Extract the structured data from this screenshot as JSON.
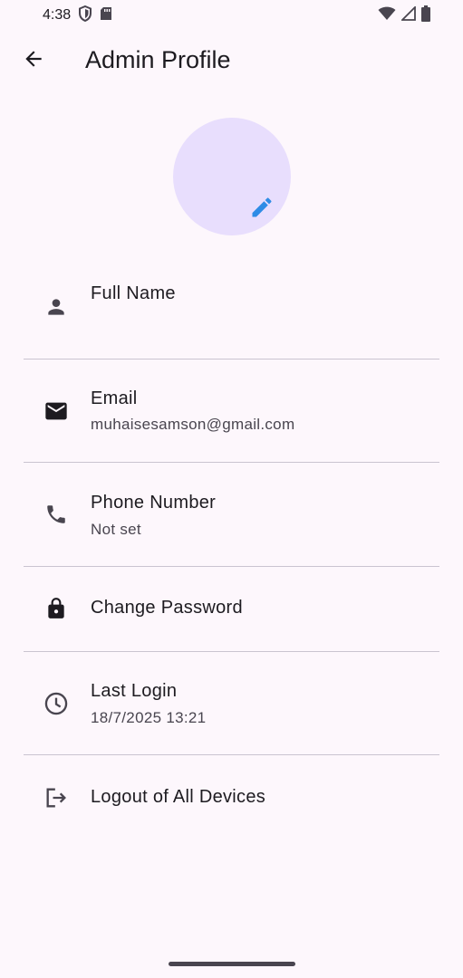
{
  "status_bar": {
    "time": "4:38"
  },
  "header": {
    "title": "Admin Profile"
  },
  "profile": {
    "items": [
      {
        "title": "Full Name",
        "subtitle": "",
        "icon": "person-icon"
      },
      {
        "title": "Email",
        "subtitle": "muhaisesamson@gmail.com",
        "icon": "mail-icon"
      },
      {
        "title": "Phone Number",
        "subtitle": "Not set",
        "icon": "phone-icon"
      },
      {
        "title": "Change Password",
        "subtitle": "",
        "icon": "lock-icon"
      },
      {
        "title": "Last Login",
        "subtitle": "18/7/2025 13:21",
        "icon": "clock-icon"
      },
      {
        "title": "Logout of All Devices",
        "subtitle": "",
        "icon": "logout-icon"
      }
    ]
  },
  "colors": {
    "background": "#fdf7fc",
    "avatar_fill": "#e8defd",
    "accent": "#2e8ce6",
    "icon": "#49454f",
    "divider": "#cac4d0"
  }
}
